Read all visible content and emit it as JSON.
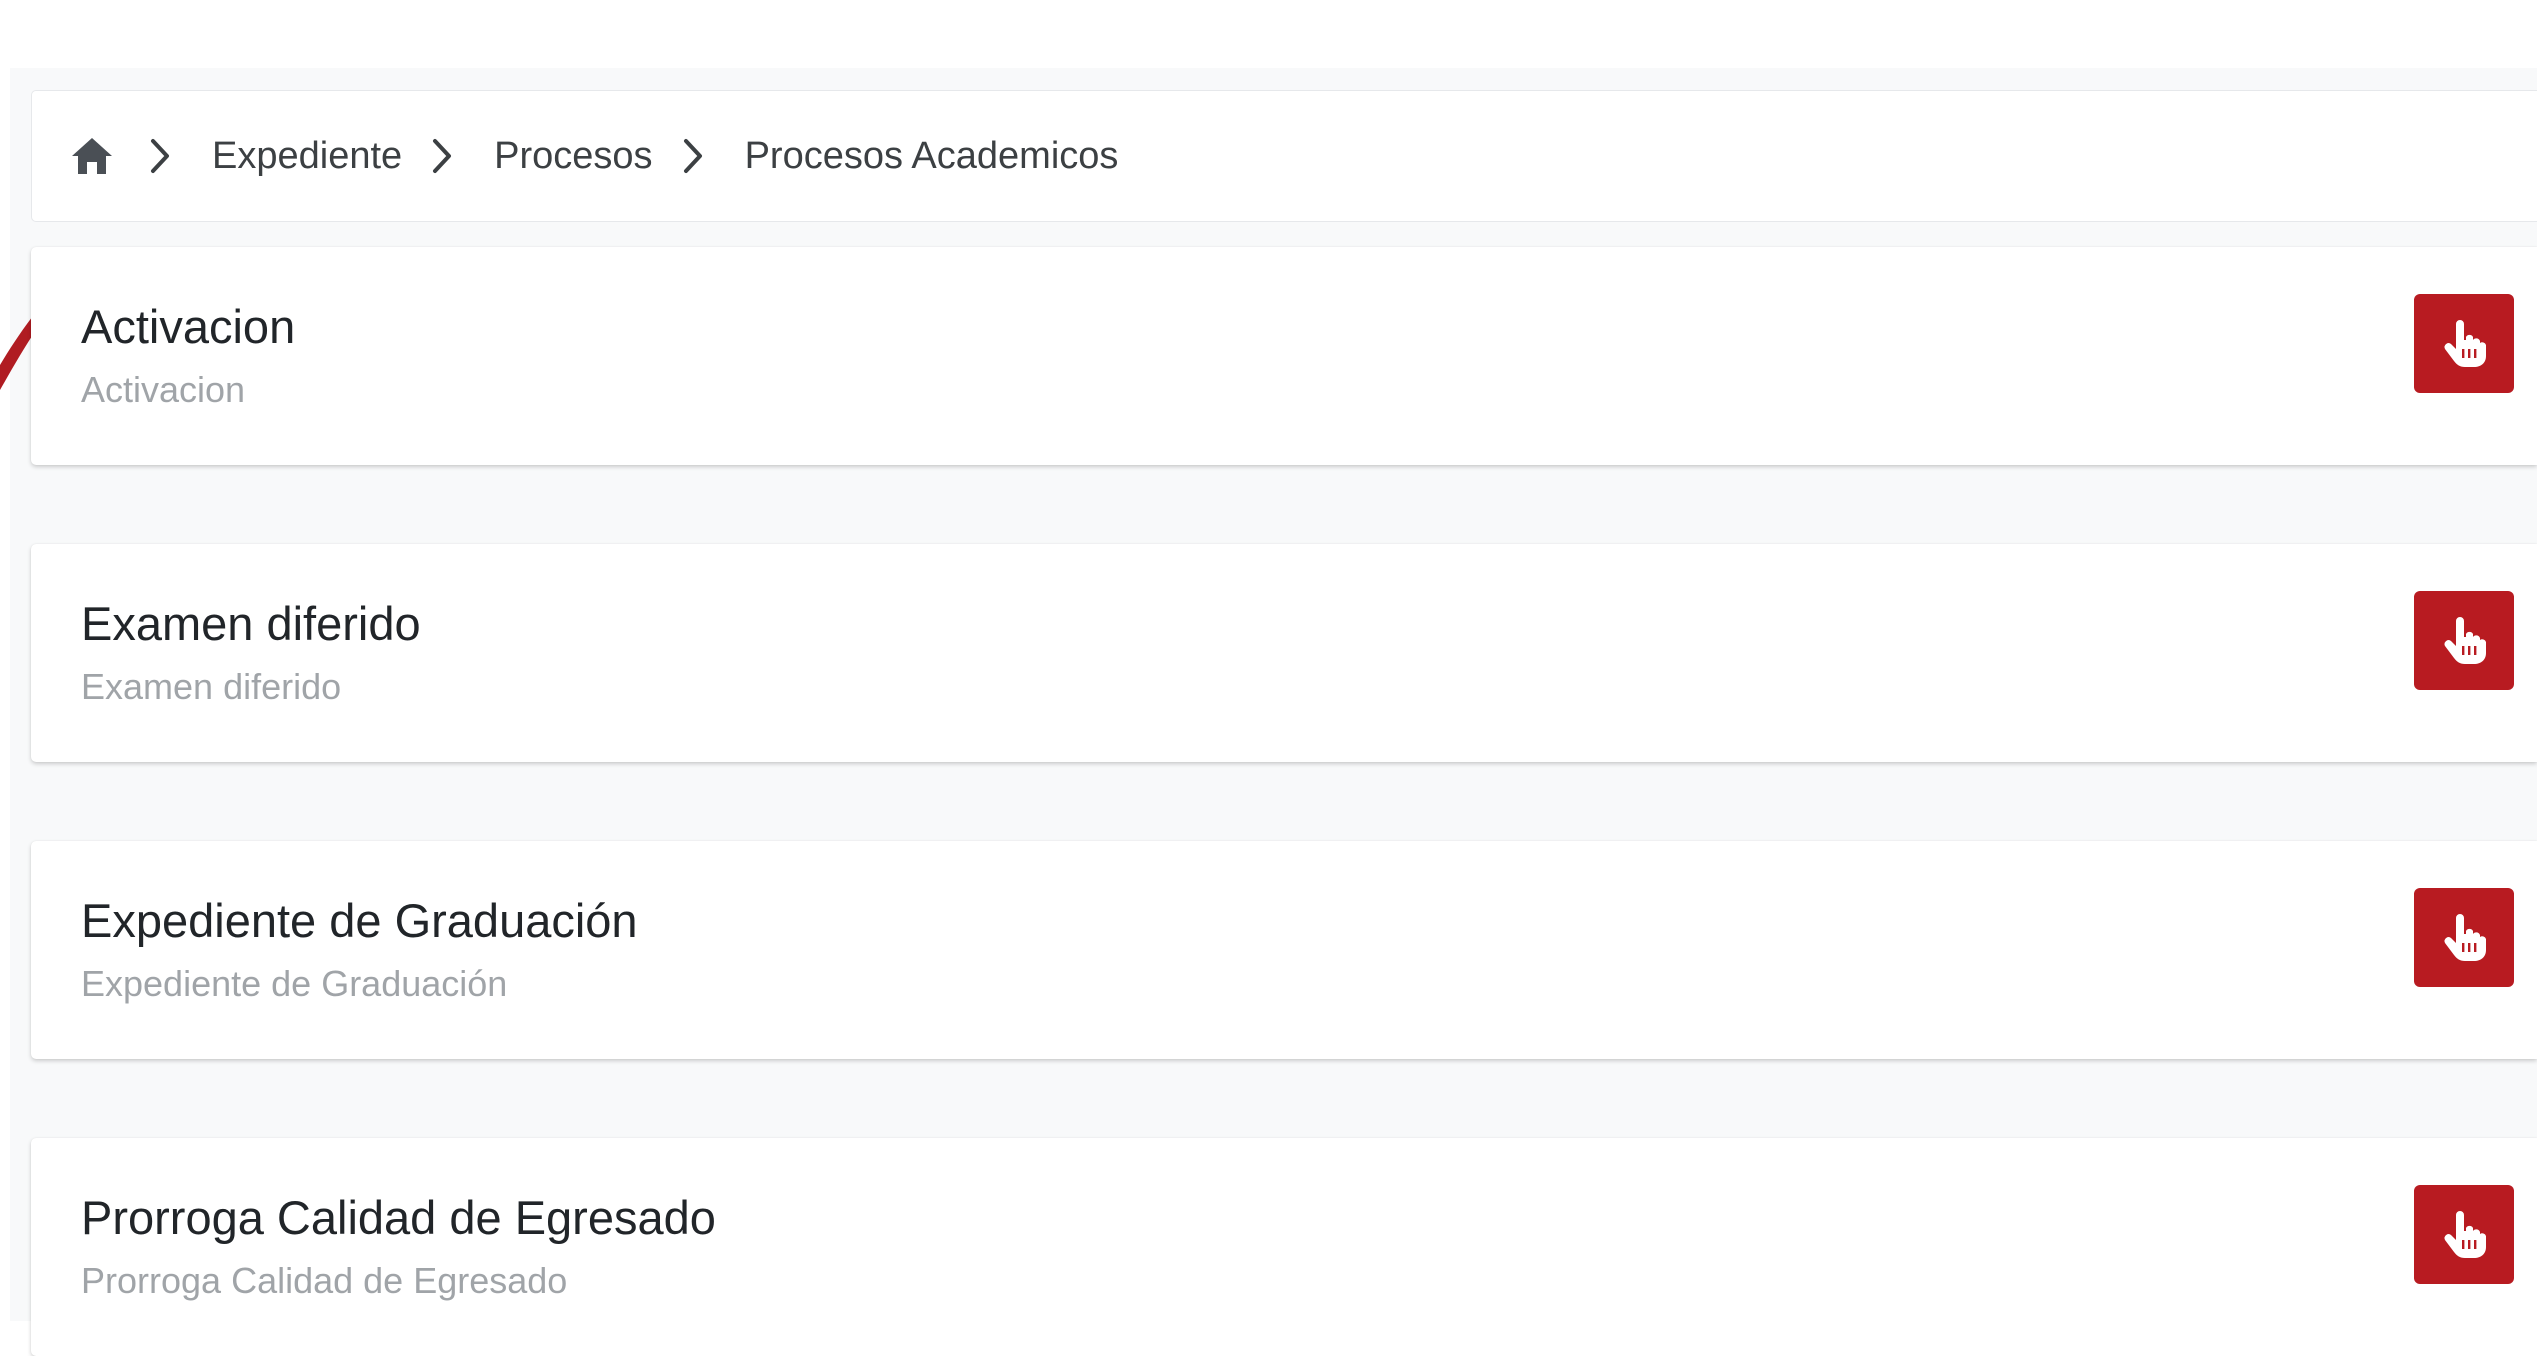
{
  "breadcrumb": {
    "home_icon": "home-icon",
    "separator_icon": "chevron-right-icon",
    "items": [
      "Expediente",
      "Procesos",
      "Procesos Academicos"
    ]
  },
  "processes": [
    {
      "title": "Activacion",
      "subtitle": "Activacion",
      "action_icon": "hand-pointer-icon"
    },
    {
      "title": "Examen diferido",
      "subtitle": "Examen diferido",
      "action_icon": "hand-pointer-icon"
    },
    {
      "title": "Expediente de Graduación",
      "subtitle": "Expediente de Graduación",
      "action_icon": "hand-pointer-icon"
    },
    {
      "title": "Prorroga Calidad de Egresado",
      "subtitle": "Prorroga Calidad de Egresado",
      "action_icon": "hand-pointer-icon"
    }
  ],
  "colors": {
    "accent": "#b81b21",
    "page_background": "#f8f9fa",
    "card_background": "#ffffff",
    "title_text": "#212529",
    "subtitle_text": "#a0a4a8"
  }
}
